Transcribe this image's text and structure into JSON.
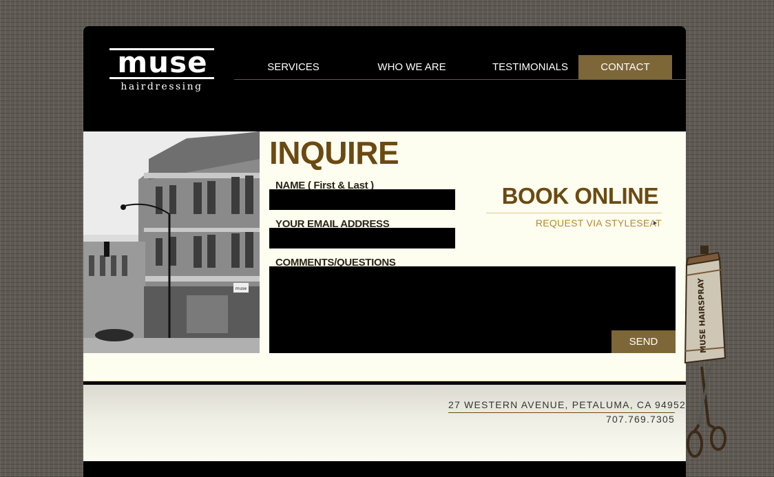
{
  "logo": {
    "word": "muse",
    "sub": "hairdressing"
  },
  "nav": {
    "items": [
      {
        "label": "SERVICES",
        "active": false
      },
      {
        "label": "WHO WE ARE",
        "active": false
      },
      {
        "label": "TESTIMONIALS",
        "active": false
      },
      {
        "label": "CONTACT",
        "active": true
      }
    ]
  },
  "form": {
    "title": "INQUIRE",
    "name_label": "NAME ( First & Last )",
    "name_value": "",
    "email_label": "YOUR EMAIL ADDRESS",
    "email_value": "",
    "comments_label": "COMMENTS/QUESTIONS",
    "comments_value": "",
    "send_label": "SEND"
  },
  "booking": {
    "title": "BOOK ONLINE",
    "link_label": "REQUEST VIA STYLESEAT"
  },
  "footer": {
    "address": "27 WESTERN AVENUE, PETALUMA, CA 94952",
    "phone": "707.769.7305"
  },
  "decoration": {
    "can_text": "MUSE HAIRSPRAY",
    "storefront_sign": "muse"
  },
  "colors": {
    "accent": "#7d6638",
    "heading": "#6b4a12",
    "link": "#b8892a",
    "content_bg": "#fdfdf0",
    "header_bg": "#000000"
  }
}
